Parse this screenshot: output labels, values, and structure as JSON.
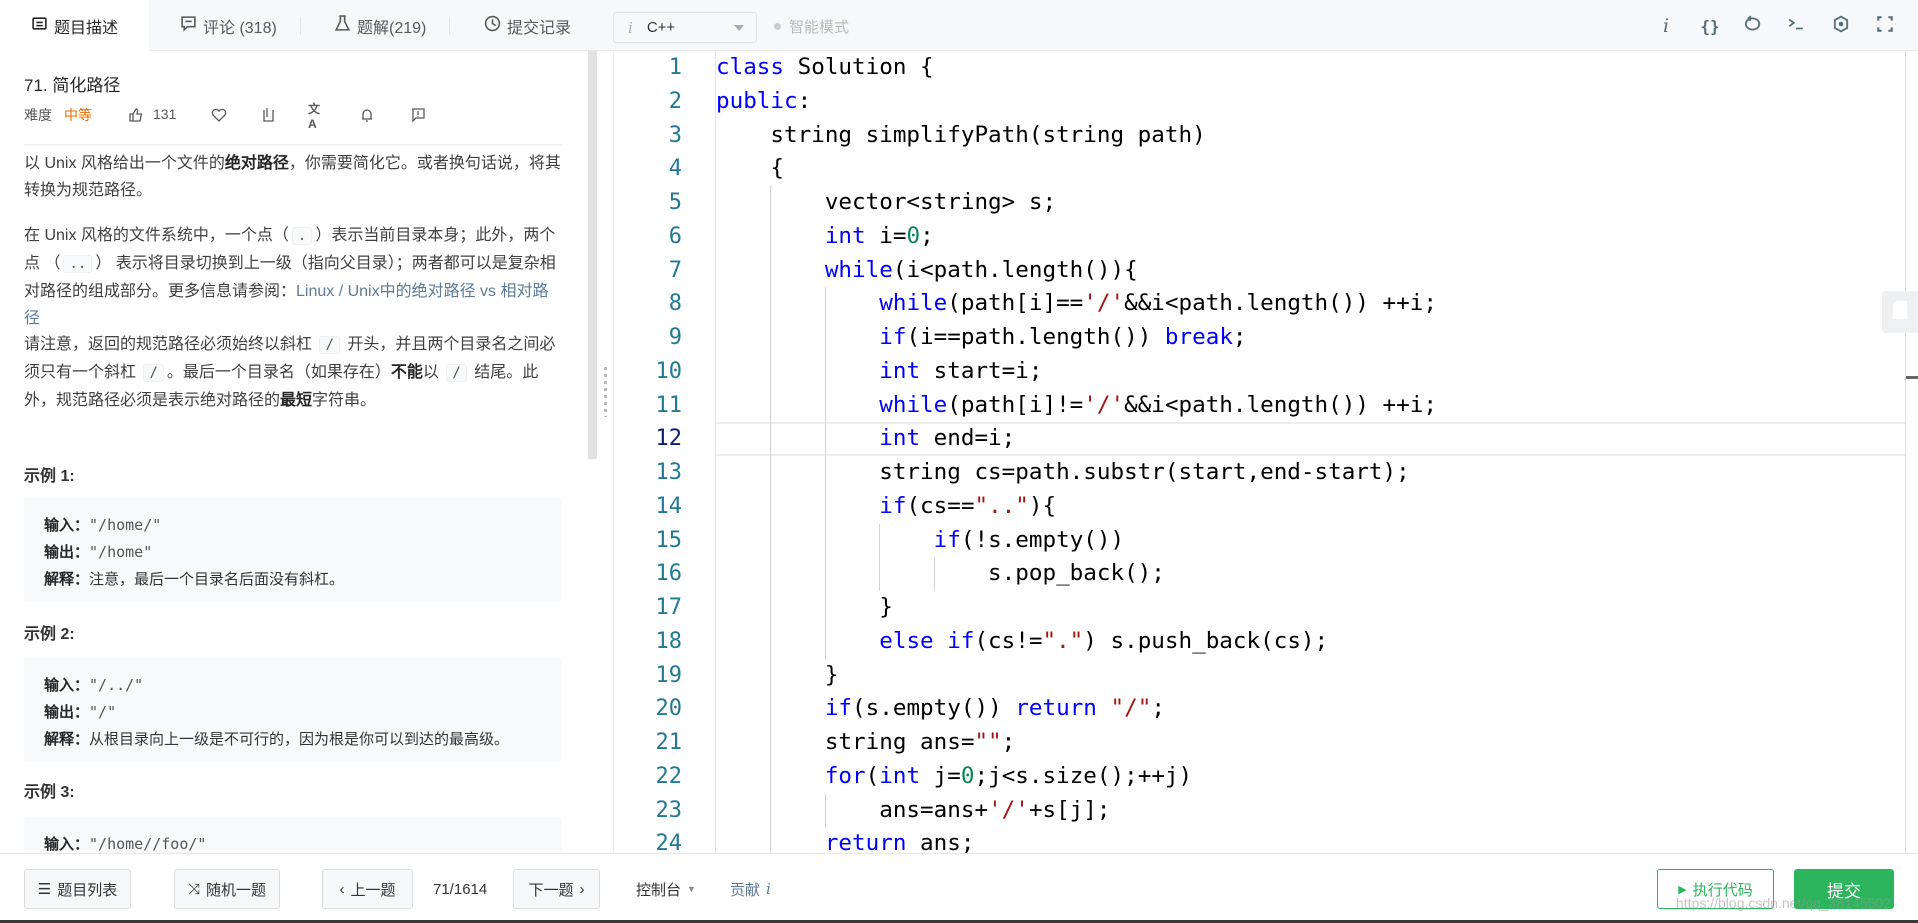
{
  "tabs": [
    {
      "label": "题目描述",
      "icon": "description-icon",
      "active": true
    },
    {
      "label": "评论 (318)",
      "icon": "comment-icon"
    },
    {
      "label": "题解(219)",
      "icon": "flask-icon"
    },
    {
      "label": "提交记录",
      "icon": "clock-icon"
    }
  ],
  "editor_toolbar": {
    "language": "C++",
    "language_icon": "i",
    "smart_mode": "智能模式",
    "icons": [
      "info-icon",
      "braces-icon",
      "reset-icon",
      "terminal-icon",
      "settings-icon",
      "fullscreen-icon"
    ]
  },
  "problem": {
    "title": "71. 简化路径",
    "difficulty_label": "难度",
    "difficulty": "中等",
    "difficulty_color": "#ef6c00",
    "likes": "131",
    "paragraphs": [
      [
        {
          "t": "以 Unix 风格给出一个文件的"
        },
        {
          "t": "绝对路径",
          "s": "bold"
        },
        {
          "t": "，你需要简化它。或者换句话说，将其转换为规范路径。"
        }
      ],
      [
        {
          "t": "在 Unix 风格的文件系统中，一个点（"
        },
        {
          "t": ".",
          "s": "code"
        },
        {
          "t": "）表示当前目录本身；此外，两个点 （"
        },
        {
          "t": "..",
          "s": "code"
        },
        {
          "t": "） 表示将目录切换到上一级（指向父目录）；两者都可以是复杂相对路径的组成部分。更多信息请参阅："
        },
        {
          "t": "Linux / Unix中的绝对路径 vs 相对路径",
          "s": "link"
        }
      ],
      [
        {
          "t": "请注意，返回的规范路径必须始终以斜杠 "
        },
        {
          "t": "/",
          "s": "code"
        },
        {
          "t": " 开头，并且两个目录名之间必须只有一个斜杠 "
        },
        {
          "t": "/",
          "s": "code"
        },
        {
          "t": "。最后一个目录名（如果存在）"
        },
        {
          "t": "不能",
          "s": "bold"
        },
        {
          "t": "以 "
        },
        {
          "t": "/",
          "s": "code"
        },
        {
          "t": " 结尾。此外，规范路径必须是表示绝对路径的"
        },
        {
          "t": "最短",
          "s": "bold"
        },
        {
          "t": "字符串。"
        }
      ]
    ],
    "examples": [
      {
        "label": "示例 1:",
        "lines": [
          {
            "k": "输入：",
            "v": "\"/home/\""
          },
          {
            "k": "输出：",
            "v": "\"/home\""
          },
          {
            "k": "解释：",
            "v": "注意，最后一个目录名后面没有斜杠。"
          }
        ]
      },
      {
        "label": "示例 2:",
        "lines": [
          {
            "k": "输入：",
            "v": "\"/../\""
          },
          {
            "k": "输出：",
            "v": "\"/\""
          },
          {
            "k": "解释：",
            "v": "从根目录向上一级是不可行的，因为根是你可以到达的最高级。"
          }
        ]
      },
      {
        "label": "示例 3:",
        "lines": [
          {
            "k": "输入：",
            "v": "\"/home//foo/\""
          }
        ]
      }
    ]
  },
  "editor": {
    "current_line": 12,
    "colors": {
      "keyword": "#0000ff",
      "string": "#a31515",
      "number": "#098658",
      "line_number": "#237893"
    },
    "lines": [
      [
        [
          "class",
          "kw"
        ],
        [
          " Solution {"
        ]
      ],
      [
        [
          "public",
          "kw"
        ],
        [
          ":"
        ]
      ],
      [
        [
          "    string simplifyPath(string path)"
        ]
      ],
      [
        [
          "    {"
        ]
      ],
      [
        [
          "        vector<string> s;"
        ]
      ],
      [
        [
          "        "
        ],
        [
          "int",
          "kw"
        ],
        [
          " i="
        ],
        [
          "0",
          "num"
        ],
        [
          ";"
        ]
      ],
      [
        [
          "        "
        ],
        [
          "while",
          "kw"
        ],
        [
          "(i<path.length()){"
        ]
      ],
      [
        [
          "            "
        ],
        [
          "while",
          "kw"
        ],
        [
          "(path[i]=="
        ],
        [
          "'/'",
          "str"
        ],
        [
          "&&i<path.length()) ++i;"
        ]
      ],
      [
        [
          "            "
        ],
        [
          "if",
          "kw"
        ],
        [
          "(i==path.length()) "
        ],
        [
          "break",
          "kw"
        ],
        [
          ";"
        ]
      ],
      [
        [
          "            "
        ],
        [
          "int",
          "kw"
        ],
        [
          " start=i;"
        ]
      ],
      [
        [
          "            "
        ],
        [
          "while",
          "kw"
        ],
        [
          "(path[i]!="
        ],
        [
          "'/'",
          "str"
        ],
        [
          "&&i<path.length()) ++i;"
        ]
      ],
      [
        [
          "            "
        ],
        [
          "int",
          "kw"
        ],
        [
          " end=i;"
        ]
      ],
      [
        [
          "            string cs=path.substr(start,end-start);"
        ]
      ],
      [
        [
          "            "
        ],
        [
          "if",
          "kw"
        ],
        [
          "(cs=="
        ],
        [
          "\"..\"",
          "str"
        ],
        [
          "){"
        ]
      ],
      [
        [
          "                "
        ],
        [
          "if",
          "kw"
        ],
        [
          "(!s.empty())"
        ]
      ],
      [
        [
          "                    s.pop_back();"
        ]
      ],
      [
        [
          "            }"
        ]
      ],
      [
        [
          "            "
        ],
        [
          "else if",
          "kw"
        ],
        [
          "(cs!="
        ],
        [
          "\".\"",
          "str"
        ],
        [
          ") s.push_back(cs);"
        ]
      ],
      [
        [
          "        }"
        ]
      ],
      [
        [
          "        "
        ],
        [
          "if",
          "kw"
        ],
        [
          "(s.empty()) "
        ],
        [
          "return",
          "kw"
        ],
        [
          " "
        ],
        [
          "\"/\"",
          "str"
        ],
        [
          ";"
        ]
      ],
      [
        [
          "        string ans="
        ],
        [
          "\"\"",
          "str"
        ],
        [
          ";"
        ]
      ],
      [
        [
          "        "
        ],
        [
          "for",
          "kw"
        ],
        [
          "("
        ],
        [
          "int",
          "kw"
        ],
        [
          " j="
        ],
        [
          "0",
          "num"
        ],
        [
          ";j<s.size();++j)"
        ]
      ],
      [
        [
          "            ans=ans+"
        ],
        [
          "'/'",
          "str"
        ],
        [
          "+s[j];"
        ]
      ],
      [
        [
          "        "
        ],
        [
          "return",
          "kw"
        ],
        [
          " ans;"
        ]
      ]
    ]
  },
  "bottom": {
    "problem_list": "题目列表",
    "random": "随机一题",
    "prev": "上一题",
    "progress": "71/1614",
    "next": "下一题",
    "console": "控制台",
    "contribute": "贡献",
    "contribute_icon": "i",
    "run": "执行代码",
    "submit": "提交",
    "accent": "#2db55d"
  },
  "watermark": "https://blog.csdn.net/qq_38145502"
}
